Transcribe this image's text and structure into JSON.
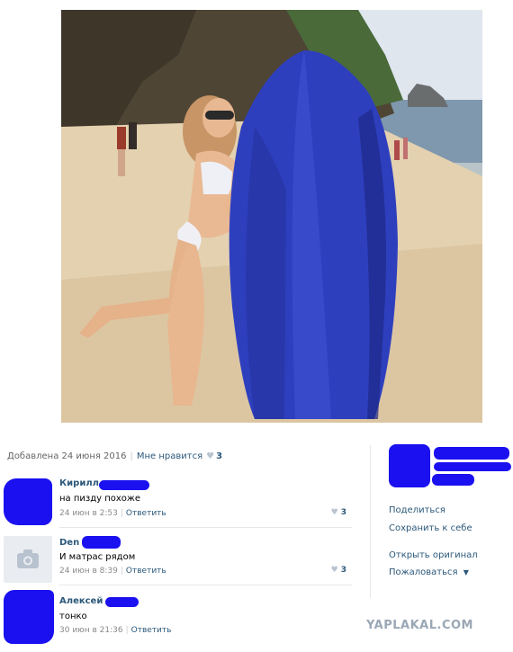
{
  "post_meta": {
    "added_label": "Добавлена 24 июня 2016",
    "like_label": "Мне нравится",
    "like_count": "3"
  },
  "comments": [
    {
      "name": "Кирилл",
      "text": "на пизду похоже",
      "time": "24 июн в 2:53",
      "reply": "Ответить",
      "likes": "3"
    },
    {
      "name": "Den",
      "text": "И матрас рядом",
      "time": "24 июн в 8:39",
      "reply": "Ответить",
      "likes": "3"
    },
    {
      "name": "Алексей",
      "text": "тонко",
      "time": "30 июн в 21:36",
      "reply": "Ответить",
      "likes": ""
    }
  ],
  "actions": {
    "share": "Поделиться",
    "save": "Сохранить к себе",
    "open_original": "Открыть оригинал",
    "report": "Пожаловаться"
  },
  "watermark": "YAPLAKAL.COM",
  "colors": {
    "link": "#2b587a",
    "scribble": "#1a10f0"
  },
  "icons": {
    "like": "heart-icon",
    "avatar_placeholder": "camera-icon",
    "dropdown": "chevron-down-icon"
  }
}
